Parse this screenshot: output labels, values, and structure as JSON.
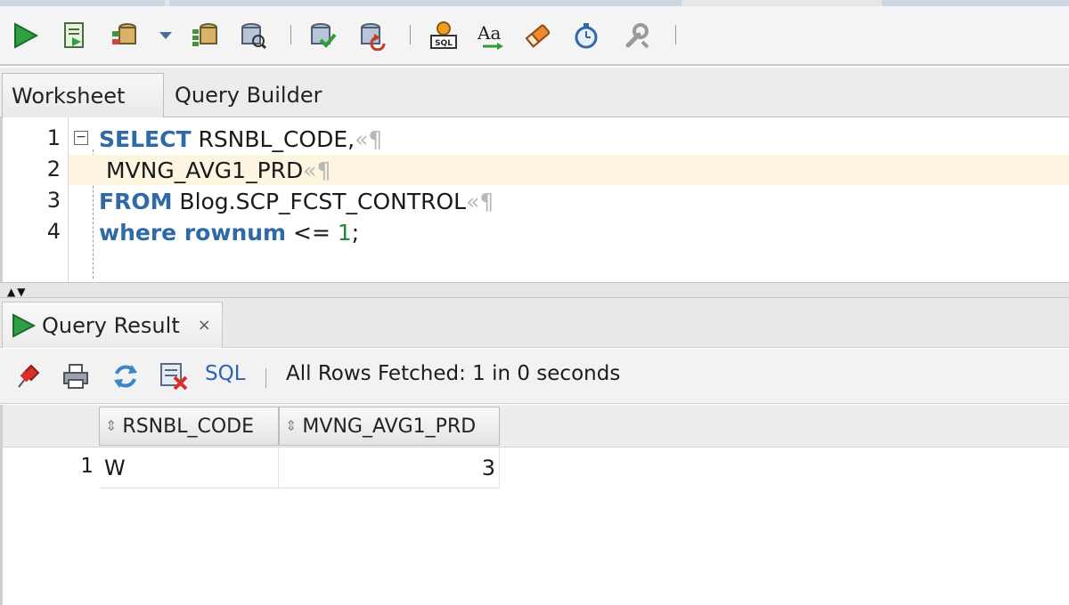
{
  "editor_tabs": [
    {
      "label": "Worksheet",
      "active": true
    },
    {
      "label": "Query Builder",
      "active": false
    }
  ],
  "toolbar_icons": [
    "run-statement-icon",
    "run-script-icon",
    "autotrace-icon",
    "dropdown-icon",
    "explain-plan-icon",
    "sql-tuning-icon",
    "commit-icon",
    "rollback-icon",
    "sql-history-icon",
    "case-format-icon",
    "clear-icon",
    "timer-icon",
    "tools-icon"
  ],
  "editor": {
    "line_numbers": [
      "1",
      "2",
      "3",
      "4"
    ],
    "lines": [
      {
        "keyword": "SELECT",
        "text": " RSNBL_CODE,",
        "mark": "«¶"
      },
      {
        "text": " MVNG_AVG1_PRD",
        "mark": "«¶"
      },
      {
        "keyword": "FROM",
        "text": " Blog.SCP_FCST_CONTROL",
        "mark": "«¶"
      },
      {
        "keyword": "where",
        "keyword2": " rownum",
        "op": " <= ",
        "number": "1",
        "end": ";"
      }
    ],
    "fold_symbol": "−",
    "split_arrows": "▲▼"
  },
  "result": {
    "tab_label": "Query Result",
    "tab_close": "×",
    "sql_link": "SQL",
    "status": "All Rows Fetched: 1 in 0 seconds",
    "sort_glyph": "⇕",
    "columns": [
      "RSNBL_CODE",
      "MVNG_AVG1_PRD"
    ],
    "rows": [
      {
        "num": "1",
        "cells": [
          "W",
          "3"
        ]
      }
    ]
  }
}
